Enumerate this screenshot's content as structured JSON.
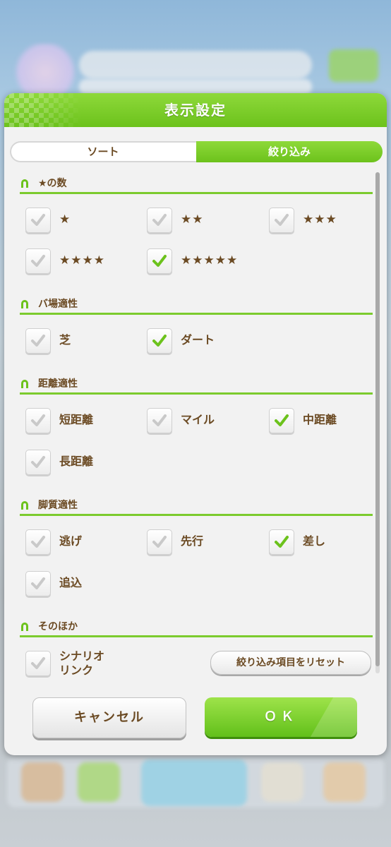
{
  "dialog": {
    "title": "表示設定",
    "tabs": [
      {
        "label": "ソート",
        "active": false
      },
      {
        "label": "絞り込み",
        "active": true
      }
    ]
  },
  "sections": [
    {
      "title": "★の数",
      "options": [
        {
          "label": "★",
          "checked": false
        },
        {
          "label": "★★",
          "checked": false
        },
        {
          "label": "★★★",
          "checked": false
        },
        {
          "label": "★★★★",
          "checked": false
        },
        {
          "label": "★★★★★",
          "checked": true
        }
      ]
    },
    {
      "title": "バ場適性",
      "options": [
        {
          "label": "芝",
          "checked": false
        },
        {
          "label": "ダート",
          "checked": true
        }
      ]
    },
    {
      "title": "距離適性",
      "options": [
        {
          "label": "短距離",
          "checked": false
        },
        {
          "label": "マイル",
          "checked": false
        },
        {
          "label": "中距離",
          "checked": true
        },
        {
          "label": "長距離",
          "checked": false
        }
      ]
    },
    {
      "title": "脚質適性",
      "options": [
        {
          "label": "逃げ",
          "checked": false
        },
        {
          "label": "先行",
          "checked": false
        },
        {
          "label": "差し",
          "checked": true
        },
        {
          "label": "追込",
          "checked": false
        }
      ]
    },
    {
      "title": "そのほか",
      "options": [
        {
          "label_line1": "シナリオ",
          "label_line2": "リンク",
          "checked": false
        }
      ]
    }
  ],
  "reset_label": "絞り込み項目をリセット",
  "buttons": {
    "cancel": "キャンセル",
    "ok": "ＯＫ"
  },
  "colors": {
    "accent_green": "#6cc21c",
    "text_brown": "#6b4a23",
    "check_gray": "#c9c9c9"
  },
  "icons": {
    "section": "horseshoe-icon",
    "check": "checkmark-icon"
  }
}
